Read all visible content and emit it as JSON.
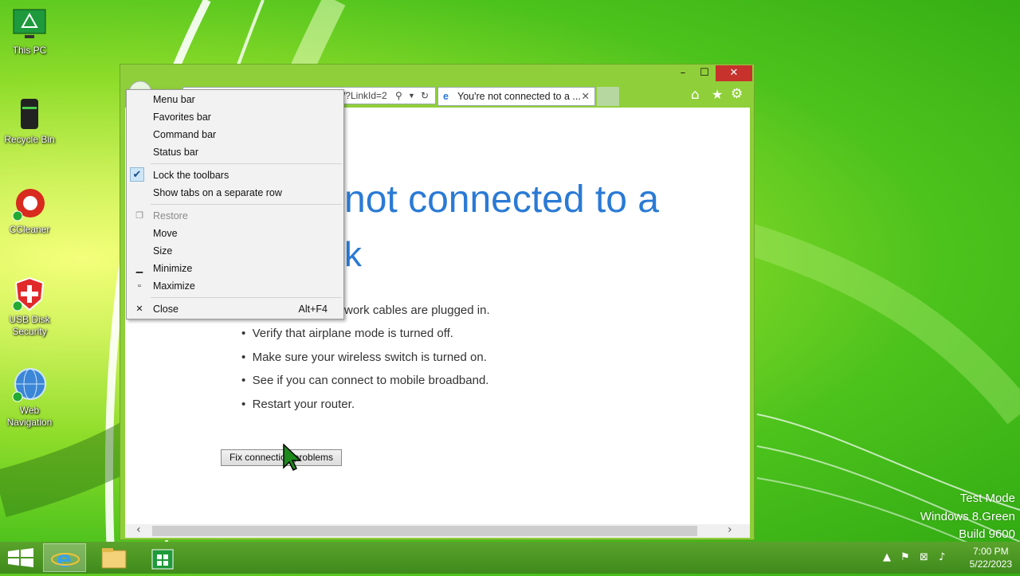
{
  "desktop": {
    "icons": [
      {
        "label": "This PC"
      },
      {
        "label": "Recycle Bin"
      },
      {
        "label": "CCleaner"
      },
      {
        "label": "USB Disk Security"
      },
      {
        "label": "Web Navigation"
      }
    ],
    "watermark": {
      "line1": "Test Mode",
      "line2": "Windows 8.Green",
      "line3": "Build 9600"
    }
  },
  "browser": {
    "address_fragment": "/?LinkId=2",
    "tab_title": "You're not connected to a ...",
    "headline_line1": "not connected to a",
    "headline_line2": "k",
    "bullets": [
      "work cables are plugged in.",
      "Verify that airplane mode is turned off.",
      "Make sure your wireless switch is turned on.",
      "See if you can connect to mobile broadband.",
      "Restart your router."
    ],
    "fix_button": "Fix connection problems",
    "caption": {
      "minimize": "–",
      "maximize": "☐",
      "close": "✕"
    }
  },
  "context_menu": {
    "items": [
      {
        "label": "Menu bar"
      },
      {
        "label": "Favorites bar"
      },
      {
        "label": "Command bar"
      },
      {
        "label": "Status bar"
      },
      {
        "label": "Lock the toolbars",
        "checked": true
      },
      {
        "label": "Show tabs on a separate row"
      },
      {
        "label": "Restore",
        "disabled": true
      },
      {
        "label": "Move"
      },
      {
        "label": "Size"
      },
      {
        "label": "Minimize"
      },
      {
        "label": "Maximize"
      },
      {
        "label": "Close",
        "accelerator": "Alt+F4"
      }
    ]
  },
  "taskbar": {
    "clock_time": "7:00 PM",
    "clock_date": "5/22/2023"
  },
  "colors": {
    "accent": "#2a7ad5",
    "close_red": "#c7322c"
  }
}
